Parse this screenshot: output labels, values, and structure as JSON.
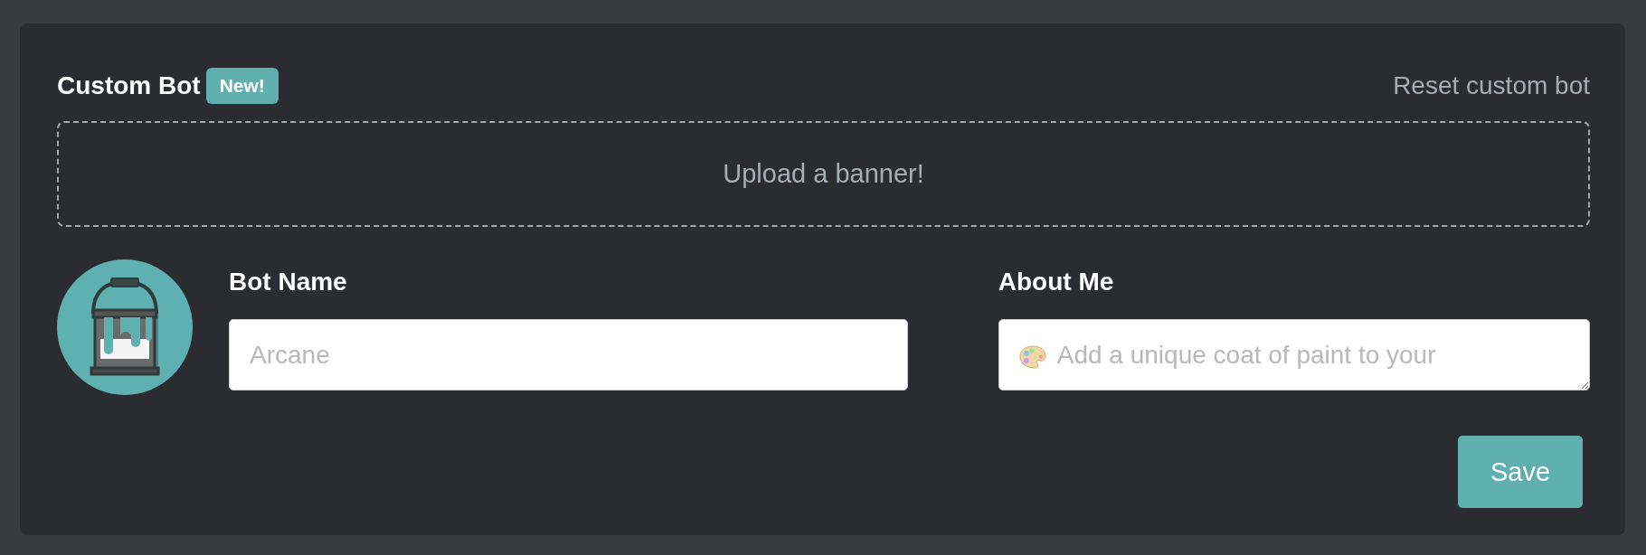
{
  "header": {
    "title": "Custom Bot",
    "badge": "New!",
    "reset_link": "Reset custom bot"
  },
  "banner_upload": {
    "label": "Upload a banner!"
  },
  "bot_name": {
    "label": "Bot Name",
    "placeholder": "Arcane"
  },
  "about_me": {
    "label": "About Me",
    "placeholder": "Add a unique coat of paint to your"
  },
  "save_button": "Save"
}
